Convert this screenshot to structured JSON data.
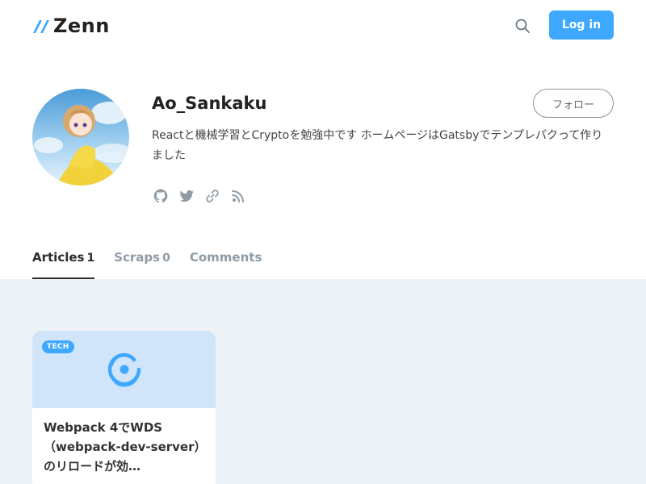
{
  "header": {
    "logo_text": "Zenn",
    "login_label": "Log in"
  },
  "profile": {
    "username": "Ao_Sankaku",
    "follow_label": "フォロー",
    "bio": "Reactと機械学習とCryptoを勉強中です ホームページはGatsbyでテンプレパクって作りました",
    "social_icons": [
      "github-icon",
      "twitter-icon",
      "link-icon",
      "rss-icon"
    ]
  },
  "tabs": [
    {
      "label": "Articles",
      "count": "1",
      "active": true
    },
    {
      "label": "Scraps",
      "count": "0",
      "active": false
    },
    {
      "label": "Comments",
      "count": "",
      "active": false
    }
  ],
  "articles": [
    {
      "badge": "TECH",
      "icon": "cyclone-icon",
      "title": "Webpack 4でWDS（webpack-dev-server）のリロードが効…"
    }
  ],
  "colors": {
    "accent": "#3ea8ff",
    "main_bg": "#edf2f7",
    "card_top": "#d0e4fa"
  }
}
